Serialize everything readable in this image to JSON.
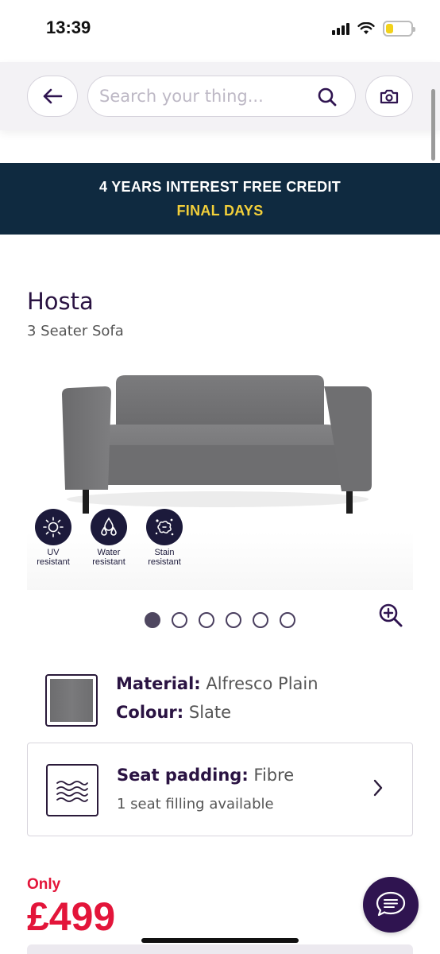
{
  "status_bar": {
    "time": "13:39"
  },
  "header": {
    "search_placeholder": "Search your thing..."
  },
  "promo": {
    "line1": "4 YEARS INTEREST FREE CREDIT",
    "line2": "FINAL DAYS"
  },
  "product": {
    "name": "Hosta",
    "subtitle": "3 Seater Sofa",
    "badges": [
      {
        "icon": "sun-icon",
        "line1": "UV",
        "line2": "resistant"
      },
      {
        "icon": "water-drops-icon",
        "line1": "Water",
        "line2": "resistant"
      },
      {
        "icon": "stain-splash-icon",
        "line1": "Stain",
        "line2": "resistant"
      }
    ],
    "gallery": {
      "total_images": 6,
      "active_index": 0
    }
  },
  "material": {
    "material_label": "Material:",
    "material_value": "Alfresco Plain",
    "colour_label": "Colour:",
    "colour_value": "Slate",
    "swatch_color": "#737375"
  },
  "seat_padding": {
    "label": "Seat padding:",
    "value": "Fibre",
    "subtitle": "1 seat filling available"
  },
  "price": {
    "label": "Only",
    "value": "£499"
  },
  "colors": {
    "brand_purple": "#2f1450",
    "promo_bg": "#0f2a40",
    "promo_accent": "#f2cf3a",
    "price_red": "#e3153a"
  }
}
